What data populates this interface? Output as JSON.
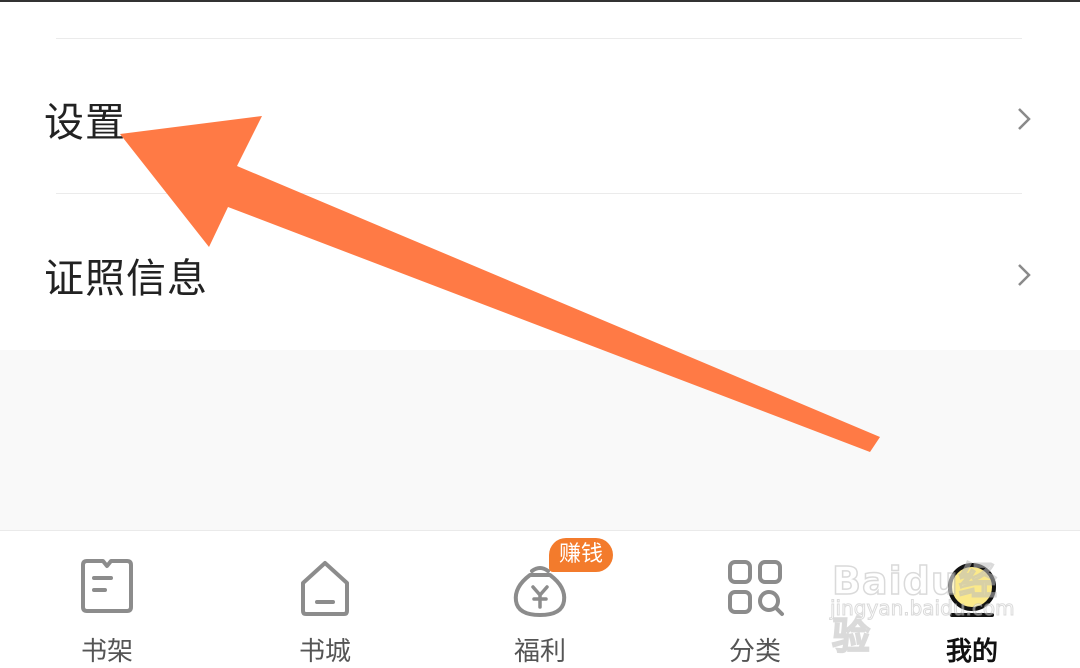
{
  "menu": {
    "items": [
      {
        "label": "设置",
        "icon": "chevron-right-icon"
      },
      {
        "label": "证照信息",
        "icon": "chevron-right-icon"
      }
    ]
  },
  "tabbar": {
    "tabs": [
      {
        "label": "书架",
        "icon": "bookshelf-icon"
      },
      {
        "label": "书城",
        "icon": "home-icon"
      },
      {
        "label": "福利",
        "icon": "money-bag-icon",
        "badge": "赚钱"
      },
      {
        "label": "分类",
        "icon": "category-grid-icon"
      },
      {
        "label": "我的",
        "icon": "profile-avatar-icon",
        "active": true
      }
    ]
  },
  "watermark": {
    "logo": "Baidu经验",
    "site": "jingyan.baidu.com"
  },
  "colors": {
    "accent": "#f37b2c",
    "annotation_arrow": "#ff7a45",
    "text": "#222222",
    "divider": "#ebebeb"
  }
}
